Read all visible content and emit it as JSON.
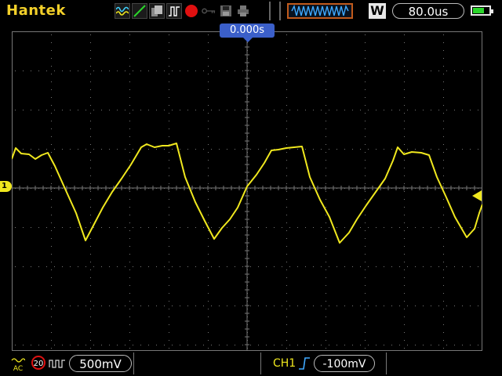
{
  "brand": "Hantek",
  "toolbar_icons": [
    "waveform-mode-icon",
    "line-mode-icon",
    "persistence-icon",
    "single-pulse-icon",
    "record-icon",
    "key-icon",
    "save-icon",
    "print-icon"
  ],
  "timebase": "80.0us",
  "window_mode": "W",
  "trigger_position": "0.000s",
  "channel_marker": "1",
  "bottom": {
    "coupling": "AC",
    "bandwidth_limit": "20",
    "volts_per_div": "500mV",
    "trigger_channel": "CH1",
    "trigger_level": "-100mV"
  },
  "colors": {
    "brand": "#f3d02a",
    "trace": "#f0e81e",
    "trigger_marker": "#3b5fc9",
    "record": "#e01010",
    "window_frame": "#c05a1c"
  }
}
